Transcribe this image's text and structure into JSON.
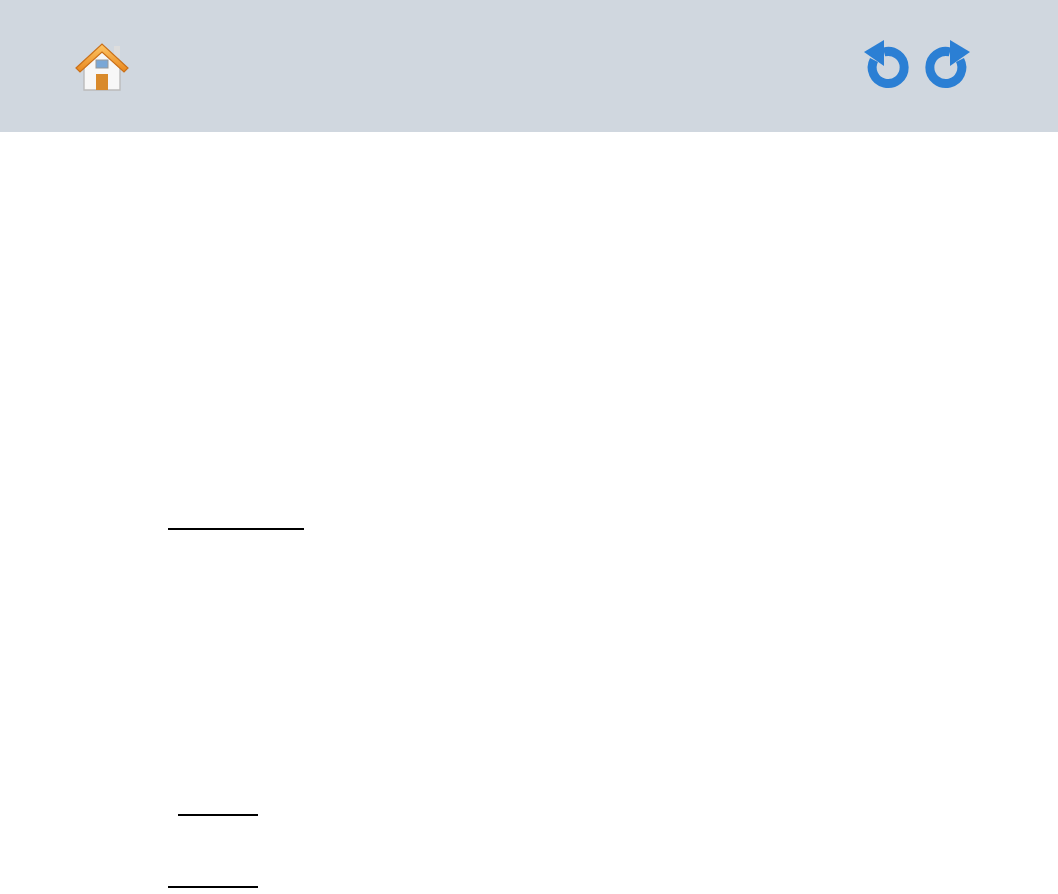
{
  "toolbar": {
    "buttons": [
      {
        "kind": "home"
      },
      {
        "kind": "undo"
      },
      {
        "kind": "redo"
      }
    ]
  },
  "blanks": [
    {
      "kind": "long"
    },
    {
      "kind": "short"
    },
    {
      "kind": "short"
    }
  ]
}
